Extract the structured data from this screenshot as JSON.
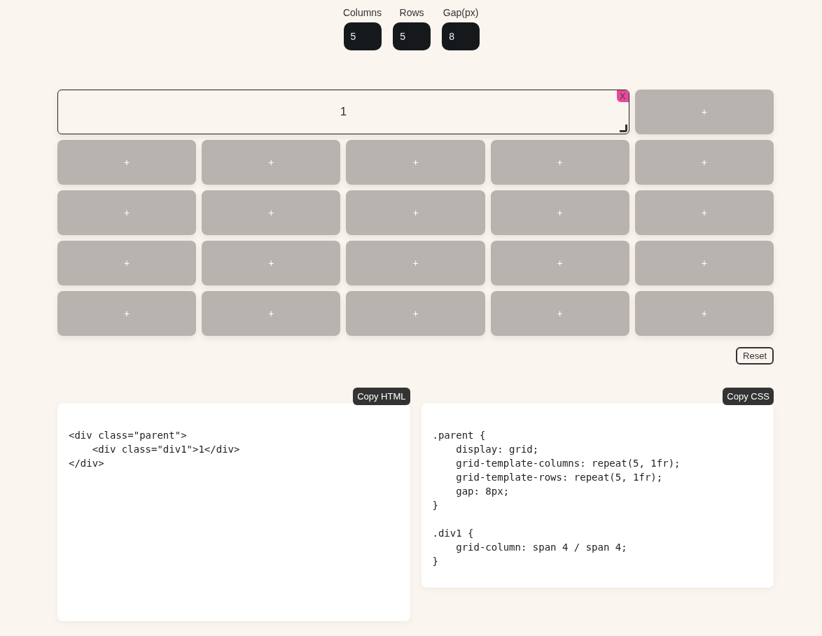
{
  "controls": [
    {
      "label": "Columns",
      "value": "5"
    },
    {
      "label": "Rows",
      "value": "5"
    },
    {
      "label": "Gap(px)",
      "value": "8"
    }
  ],
  "grid": {
    "items": [
      {
        "label": "1",
        "remove": "X"
      }
    ],
    "empty_cells": [
      "+",
      "+",
      "+",
      "+",
      "+",
      "+",
      "+",
      "+",
      "+",
      "+",
      "+",
      "+",
      "+",
      "+",
      "+",
      "+",
      "+",
      "+",
      "+",
      "+",
      "+"
    ]
  },
  "reset_button": "Reset",
  "panels": [
    {
      "button": "Copy HTML",
      "blocks": [
        [
          "<div class=\"parent\">",
          "    <div class=\"div1\">1</div>",
          "</div>"
        ]
      ]
    },
    {
      "button": "Copy CSS",
      "blocks": [
        [
          ".parent {",
          "    display: grid;",
          "    grid-template-columns: repeat(5, 1fr);",
          "    grid-template-rows: repeat(5, 1fr);",
          "    gap: 8px;",
          "}"
        ],
        [
          ".div1 {",
          "    grid-column: span 4 / span 4;",
          "}"
        ]
      ]
    }
  ]
}
